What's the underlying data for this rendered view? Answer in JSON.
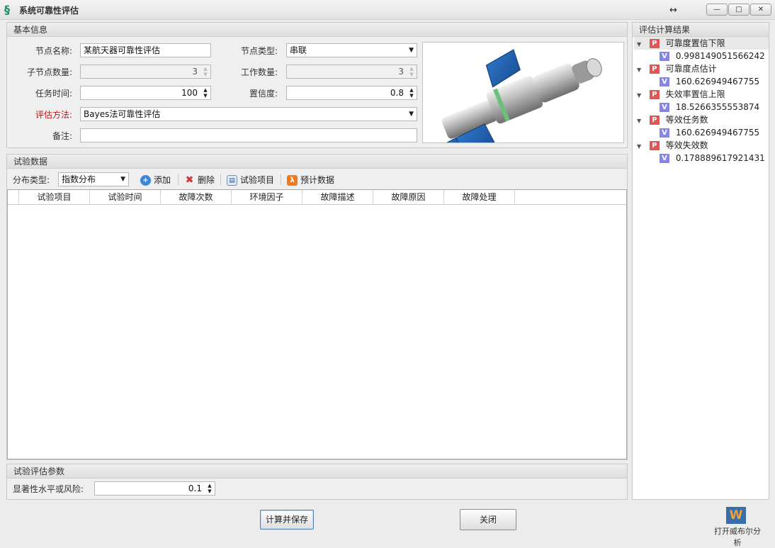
{
  "window": {
    "title": "系统可靠性评估",
    "resize_glyph": "↔",
    "icon": "app-logo-icon",
    "controls": {
      "minimize": "—",
      "maximize": "□",
      "close": "✕"
    }
  },
  "basic": {
    "header": "基本信息",
    "node_name_label": "节点名称:",
    "node_name_value": "某航天器可靠性评估",
    "node_type_label": "节点类型:",
    "node_type_value": "串联",
    "child_count_label": "子节点数量:",
    "child_count_value": "3",
    "work_count_label": "工作数量:",
    "work_count_value": "3",
    "mission_time_label": "任务时间:",
    "mission_time_value": "100",
    "confidence_label": "置信度:",
    "confidence_value": "0.8",
    "method_label": "评估方法:",
    "method_value": "Bayes法可靠性评估",
    "remark_label": "备注:",
    "remark_value": ""
  },
  "test": {
    "header": "试验数据",
    "dist_label": "分布类型:",
    "dist_value": "指数分布",
    "toolbar": {
      "add": "添加",
      "delete": "删除",
      "items": "试验项目",
      "estimate": "预计数据"
    },
    "columns": [
      "试验项目",
      "试验时间",
      "故障次数",
      "环境因子",
      "故障描述",
      "故障原因",
      "故障处理"
    ]
  },
  "params": {
    "header": "试验评估参数",
    "alpha_label": "显著性水平或风险:",
    "alpha_value": "0.1"
  },
  "results": {
    "header": "评估计算结果",
    "badge_p": "P",
    "badge_v": "V",
    "items": [
      {
        "name": "可靠度置信下限",
        "value": "0.998149051566242"
      },
      {
        "name": "可靠度点估计",
        "value": "160.626949467755"
      },
      {
        "name": "失效率置信上限",
        "value": "18.5266355553874"
      },
      {
        "name": "等效任务数",
        "value": "160.626949467755"
      },
      {
        "name": "等效失效数",
        "value": "0.178889617921431"
      }
    ]
  },
  "buttons": {
    "calc_save": "计算并保存",
    "close": "关闭"
  },
  "weibull": {
    "logo_letter": "W",
    "label": "打开威布尔分析"
  }
}
